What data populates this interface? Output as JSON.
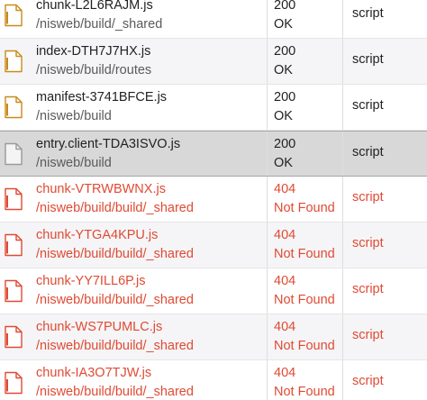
{
  "colors": {
    "ok_text": "#222222",
    "error_text": "#e04a33",
    "script_icon_accent": "#c98a1a",
    "document_icon": "#9a9a9a",
    "selected_row_bg": "#d8d8d8"
  },
  "requests": [
    {
      "name": "chunk-L2L6RAJM.js",
      "path": "/nisweb/build/_shared",
      "status_code": "200",
      "status_text": "OK",
      "type": "script",
      "icon": "script-file-icon",
      "state": "ok"
    },
    {
      "name": "index-DTH7J7HX.js",
      "path": "/nisweb/build/routes",
      "status_code": "200",
      "status_text": "OK",
      "type": "script",
      "icon": "script-file-icon",
      "state": "ok"
    },
    {
      "name": "manifest-3741BFCE.js",
      "path": "/nisweb/build",
      "status_code": "200",
      "status_text": "OK",
      "type": "script",
      "icon": "script-file-icon",
      "state": "ok"
    },
    {
      "name": "entry.client-TDA3ISVO.js",
      "path": "/nisweb/build",
      "status_code": "200",
      "status_text": "OK",
      "type": "script",
      "icon": "document-icon",
      "state": "selected"
    },
    {
      "name": "chunk-VTRWBWNX.js",
      "path": "/nisweb/build/build/_shared",
      "status_code": "404",
      "status_text": "Not Found",
      "type": "script",
      "icon": "error-file-icon",
      "state": "error"
    },
    {
      "name": "chunk-YTGA4KPU.js",
      "path": "/nisweb/build/build/_shared",
      "status_code": "404",
      "status_text": "Not Found",
      "type": "script",
      "icon": "error-file-icon",
      "state": "error"
    },
    {
      "name": "chunk-YY7ILL6P.js",
      "path": "/nisweb/build/build/_shared",
      "status_code": "404",
      "status_text": "Not Found",
      "type": "script",
      "icon": "error-file-icon",
      "state": "error"
    },
    {
      "name": "chunk-WS7PUMLC.js",
      "path": "/nisweb/build/build/_shared",
      "status_code": "404",
      "status_text": "Not Found",
      "type": "script",
      "icon": "error-file-icon",
      "state": "error"
    },
    {
      "name": "chunk-IA3O7TJW.js",
      "path": "/nisweb/build/build/_shared",
      "status_code": "404",
      "status_text": "Not Found",
      "type": "script",
      "icon": "error-file-icon",
      "state": "error"
    }
  ]
}
